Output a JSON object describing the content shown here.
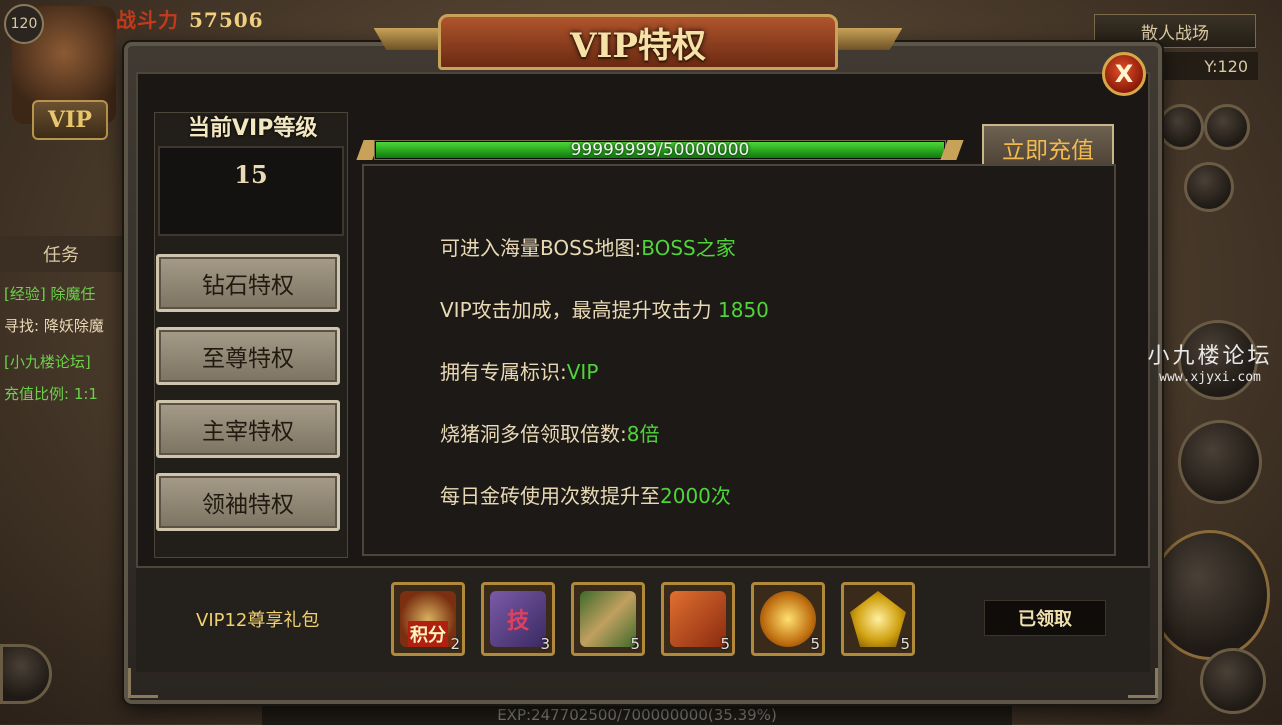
{
  "hud": {
    "level": "120",
    "power_label": "战斗力",
    "power_value": "57506",
    "vip_badge": "VIP",
    "scene_name": "散人战场",
    "coord": "Y:120",
    "exp": "EXP:247702500/700000000(35.39%)",
    "task_tab": "任务",
    "task_lines": [
      {
        "text": "[经验] 除魔任",
        "color": "#6bd04a"
      },
      {
        "text": "寻找: 降妖除魔",
        "color": "#d8c9a2"
      },
      {
        "text": "[小九楼论坛]",
        "color": "#6bd04a"
      },
      {
        "text": "充值比例: 1:1",
        "color": "#6bd04a"
      }
    ],
    "watermark": {
      "name": "小九楼论坛",
      "url": "www.xjyxi.com"
    }
  },
  "dialog": {
    "title": "VIP特权",
    "close_label": "X",
    "current_level_label": "当前VIP等级",
    "current_level": "15",
    "tiers": [
      "钻石特权",
      "至尊特权",
      "主宰特权",
      "领袖特权"
    ],
    "progress": {
      "text": "99999999/50000000",
      "fraction": 1.0
    },
    "recharge_label": "立即充值",
    "privileges": [
      {
        "text": "可进入海量BOSS地图:",
        "highlight": "BOSS之家"
      },
      {
        "text": "VIP攻击加成，最高提升攻击力",
        "highlight": "1850"
      },
      {
        "text": "拥有专属标识:",
        "highlight": "VIP"
      },
      {
        "text": "烧猪洞多倍领取倍数:",
        "highlight": "8倍"
      },
      {
        "text": "每日金砖使用次数提升至",
        "highlight": "2000次"
      }
    ],
    "gift_label": "VIP12尊享礼包",
    "gift_items": [
      {
        "icon": "points-medal-icon",
        "count": "2",
        "overlay": "积分"
      },
      {
        "icon": "skill-book-icon",
        "count": "3",
        "overlay": "技"
      },
      {
        "icon": "scroll-pair-icon",
        "count": "5",
        "overlay": ""
      },
      {
        "icon": "red-scroll-icon",
        "count": "5",
        "overlay": ""
      },
      {
        "icon": "gold-orb-icon",
        "count": "5",
        "overlay": ""
      },
      {
        "icon": "gold-gem-icon",
        "count": "5",
        "overlay": ""
      }
    ],
    "claim_status": "已领取"
  },
  "colors": {
    "highlight_green": "#4fd53a",
    "recharge_text": "#f2b94e",
    "gift_label": "#f0d070"
  }
}
